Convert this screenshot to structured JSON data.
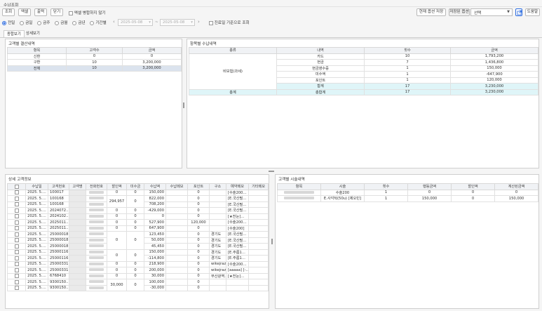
{
  "page_title": "수납조회",
  "toolbar": {
    "query": "조회",
    "excel": "엑셀",
    "print": "출력",
    "close": "닫기",
    "excel_merge_label": "엑셀 병합하지 않기",
    "save_current": "현재 옵션 저장",
    "saved_options_label": "저장된 옵션",
    "saved_options_value": "선택",
    "help": "도움말"
  },
  "filters": {
    "radios": [
      "전일",
      "금일",
      "금주",
      "금월",
      "금년",
      "기간별"
    ],
    "date_from": "2025-05-08",
    "date_sep": "~",
    "date_to": "2025-05-08",
    "clinic_date_label": "진료일 기준으로 조회"
  },
  "tabs": [
    "종합보기",
    "상세보기"
  ],
  "customer_summary": {
    "title": "고객별 결산내역",
    "columns": [
      "항목",
      "고객수",
      "금액"
    ],
    "rows": [
      [
        "신환",
        "0",
        "0"
      ],
      [
        "구환",
        "10",
        "3,200,000"
      ],
      [
        "전체",
        "10",
        "3,200,000"
      ]
    ]
  },
  "item_summary": {
    "title": "항목별 수납내역",
    "columns": [
      "종류",
      "내역",
      "횟수",
      "금액"
    ],
    "group_label": "비보험(과세)",
    "rows": [
      [
        "카드",
        "10",
        "1,793,200"
      ],
      [
        "현금",
        "7",
        "1,436,800"
      ],
      [
        "현금영수증",
        "1",
        "150,000"
      ],
      [
        "미수액",
        "1",
        "-647,900"
      ],
      [
        "포인트",
        "1",
        "120,000"
      ],
      [
        "합계",
        "17",
        "3,230,000"
      ]
    ],
    "total_label": "총계",
    "total_row": [
      "총합계",
      "17",
      "3,230,000"
    ]
  },
  "detail": {
    "title": "상세 고객정보",
    "columns": [
      "",
      "수납일",
      "고객번호",
      "고객명",
      "전화번호",
      "할인액",
      "미수금",
      "수납액",
      "수납메모",
      "포인트",
      "구소",
      "예약메모",
      "기타메모"
    ],
    "rows": [
      [
        "2025. 5.…",
        "100017",
        "0",
        "0",
        "150,000",
        "",
        "0",
        "",
        "[수술200…"
      ],
      [
        "2025. 5.…",
        "100168",
        "",
        "",
        "822,000",
        "",
        "0",
        "",
        "[E.국산필…"
      ],
      [
        "2025. 5.…",
        "100168",
        "",
        "",
        "708,200",
        "",
        "0",
        "",
        "[E.국산필…"
      ],
      [
        "2025. 5.…",
        "2024072…",
        "0",
        "0",
        "-429,000",
        "",
        "0",
        "",
        "[E.국산필…"
      ],
      [
        "2025. 5.…",
        "2024102…",
        "0",
        "0",
        "0",
        "",
        "0",
        "",
        "[★전눈]…"
      ],
      [
        "2025. 5.…",
        "2025011…",
        "0",
        "0",
        "527,900",
        "",
        "120,000",
        "",
        "[수술200…"
      ],
      [
        "2025. 5.…",
        "2025011…",
        "0",
        "0",
        "647,900",
        "",
        "0",
        "",
        "[수술200]"
      ],
      [
        "2025. 5.…",
        "25000018",
        "",
        "",
        "123,450",
        "",
        "0",
        "경기도",
        "[E.국산필…"
      ],
      [
        "2025. 5.…",
        "25000018",
        "",
        "",
        "50,000",
        "",
        "0",
        "경기도",
        "[E.국산필…"
      ],
      [
        "2025. 5.…",
        "25000018",
        "",
        "",
        "45,450",
        "",
        "0",
        "경기도",
        "[E.국산필…"
      ],
      [
        "2025. 5.…",
        "25000116",
        "",
        "",
        "150,000",
        "",
        "0",
        "경기도",
        "[E.주름1…"
      ],
      [
        "2025. 5.…",
        "25000116",
        "",
        "",
        "-114,800",
        "",
        "0",
        "경기도",
        "[E.주름1…"
      ],
      [
        "2025. 5.…",
        "25000331",
        "0",
        "0",
        "218,900",
        "",
        "0",
        "wikejraza…",
        "[수술200…"
      ],
      [
        "2025. 5.…",
        "25000331",
        "0",
        "0",
        "200,000",
        "",
        "0",
        "wikejraza…",
        "[aaaaa] [-…"
      ],
      [
        "2025. 5.…",
        "6768410",
        "0",
        "0",
        "30,000",
        "",
        "0",
        "무산광역…",
        "[★전눈]…"
      ],
      [
        "2025. 5.…",
        "9300150…",
        "",
        "",
        "100,000",
        "",
        "0",
        "",
        ""
      ],
      [
        "2025. 5.…",
        "9300150…",
        "",
        "",
        "-30,000",
        "",
        "0",
        "",
        ""
      ]
    ],
    "merged_discounts": [
      {
        "start": 1,
        "span": 2,
        "discount": "294,957",
        "unpaid": "0"
      },
      {
        "start": 7,
        "span": 3,
        "discount": "0",
        "unpaid": "0"
      },
      {
        "start": 10,
        "span": 2,
        "discount": "0",
        "unpaid": "0"
      },
      {
        "start": 15,
        "span": 2,
        "discount": "30,000",
        "unpaid": "0"
      }
    ]
  },
  "treatment": {
    "title": "고객별 시술내역",
    "columns": [
      "항목",
      "시술",
      "횟수",
      "행동금액",
      "할인액",
      "계산된금액"
    ],
    "rows": [
      [
        "",
        "수술200",
        "1",
        "0",
        "0",
        "0"
      ],
      [
        "",
        "E.사각턱(50u) [제오민]",
        "1",
        "150,000",
        "0",
        "150,000"
      ]
    ]
  }
}
